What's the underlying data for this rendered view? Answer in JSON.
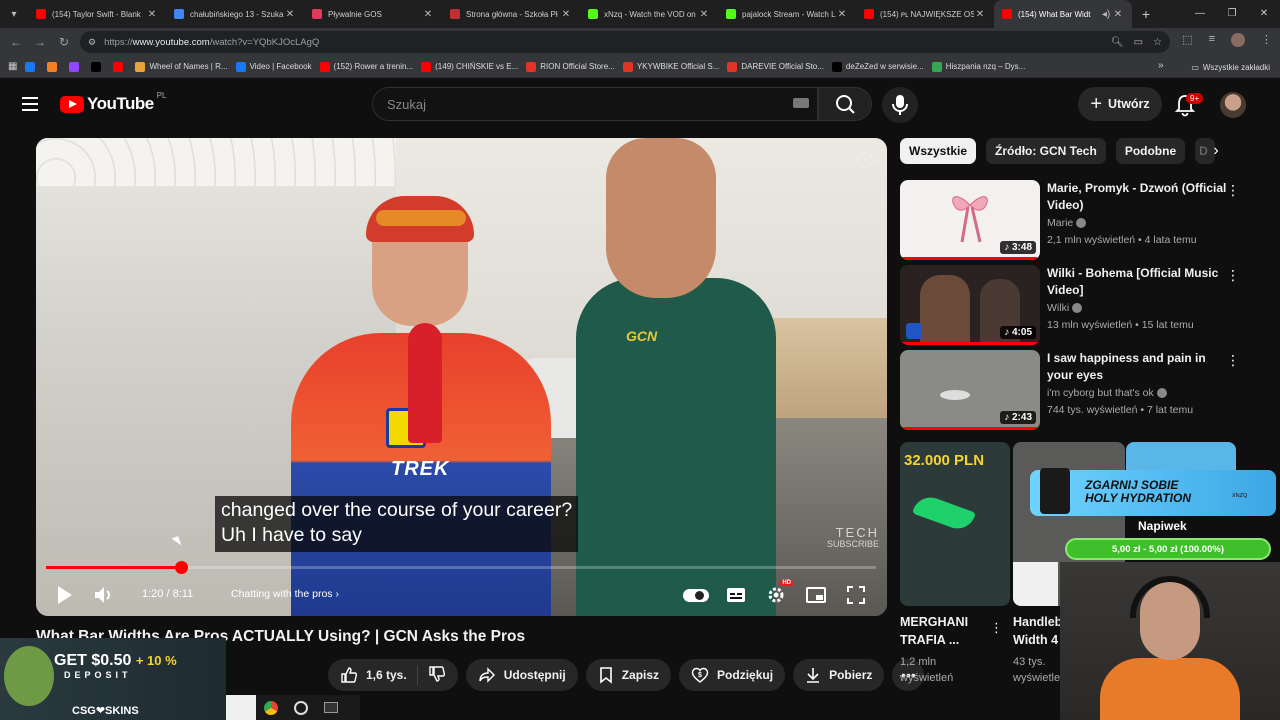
{
  "browser": {
    "tabs": [
      {
        "title": "(154) Taylor Swift - Blank",
        "icon": "youtube-icon",
        "color": "#ff0000"
      },
      {
        "title": "chałubińskiego 13 - Szuka",
        "icon": "google-icon",
        "color": "#4285f4"
      },
      {
        "title": "Pływalnie GOS",
        "icon": "bookmark-icon",
        "color": "#e03a5a"
      },
      {
        "title": "Strona główna - Szkoła Pł",
        "icon": "site-icon",
        "color": "#c03030"
      },
      {
        "title": "xNzq - Watch the VOD on",
        "icon": "kick-icon",
        "color": "#53fc18"
      },
      {
        "title": "pajalock Stream - Watch L",
        "icon": "kick-icon",
        "color": "#53fc18"
      },
      {
        "title": "(154) ᴘʟ NAJWIĘKSZE OSI",
        "icon": "youtube-icon",
        "color": "#ff0000"
      },
      {
        "title": "(154) What Bar Widt",
        "icon": "youtube-icon",
        "color": "#ff0000",
        "active": true
      }
    ],
    "url_prefix": "https://",
    "url_domain": "www.youtube.com",
    "url_path": "/watch?v=YQbKJOcLAgQ",
    "bookmarks": [
      {
        "label": "",
        "icon": "facebook-icon",
        "color": "#1877f2"
      },
      {
        "label": "",
        "icon": "orange-icon",
        "color": "#f58220"
      },
      {
        "label": "",
        "icon": "twitch-icon",
        "color": "#9146ff"
      },
      {
        "label": "",
        "icon": "x-icon",
        "color": "#000000"
      },
      {
        "label": "",
        "icon": "youtube-icon",
        "color": "#ff0000"
      },
      {
        "label": "Wheel of Names | R...",
        "icon": "wheel-icon",
        "color": "#e8a33a"
      },
      {
        "label": "Video | Facebook",
        "icon": "facebook-icon",
        "color": "#1877f2"
      },
      {
        "label": "(152) Rower a trenin...",
        "icon": "youtube-icon",
        "color": "#ff0000"
      },
      {
        "label": "(149) CHIŃSKIE vs E...",
        "icon": "youtube-icon",
        "color": "#ff0000"
      },
      {
        "label": "RION Official Store...",
        "icon": "ali-icon",
        "color": "#e43225"
      },
      {
        "label": "YKYWBIKE Official S...",
        "icon": "ali-icon",
        "color": "#e43225"
      },
      {
        "label": "DAREVIE Official Sto...",
        "icon": "ali-icon",
        "color": "#e43225"
      },
      {
        "label": "deZeZed w serwisie...",
        "icon": "x-icon",
        "color": "#000000"
      },
      {
        "label": "Hiszpania nzq – Dys...",
        "icon": "drive-icon",
        "color": "#34a853"
      }
    ],
    "all_bookmarks": "Wszystkie zakładki"
  },
  "youtube": {
    "logo_text": "YouTube",
    "country": "PL",
    "search_placeholder": "Szukaj",
    "create_label": "Utwórz",
    "notifications_badge": "9+"
  },
  "player": {
    "caption_line1": "changed over the course of your career?",
    "caption_line2": "Uh I have to say",
    "time": "1:20 / 8:11",
    "progress": 0.163,
    "chapter": "Chatting with the pros",
    "watermark_line1": "TECH",
    "watermark_line2": "SUBSCRIBE",
    "kit_sponsor": "TREK",
    "host_logo": "GCN"
  },
  "video": {
    "title": "What Bar Widths Are Pros ACTUALLY Using? | GCN Asks the Pros",
    "likes": "1,6 tys.",
    "share": "Udostępnij",
    "save": "Zapisz",
    "thanks": "Podziękuj",
    "download": "Pobierz"
  },
  "sidebar": {
    "chips": [
      "Wszystkie",
      "Źródło: GCN Tech",
      "Podobne",
      "D"
    ],
    "recommendations": [
      {
        "title": "Marie, Promyk - Dzwoń (Official Video)",
        "channel": "Marie",
        "meta": "2,1 mln wyświetleń • 4 lata temu",
        "duration": "3:48",
        "progress": 0.98,
        "thumb": "#f4f0f0"
      },
      {
        "title": "Wilki - Bohema [Official Music Video]",
        "channel": "Wilki",
        "meta": "13 mln wyświetleń • 15 lat temu",
        "duration": "4:05",
        "progress": 1.0,
        "thumb": "#2a2220"
      },
      {
        "title": "I saw happiness and pain in your eyes",
        "channel": "i'm cyborg but that's ok",
        "meta": "744 tys. wyświetleń • 7 lat temu",
        "duration": "2:43",
        "progress": 1.0,
        "thumb": "#8a8a86"
      }
    ],
    "grid": [
      {
        "title_l1": "MERGHANI",
        "title_l2": "TRAFIA ...",
        "meta_l1": "1,2 mln",
        "meta_l2": "wyświetleń",
        "thumb_text": "32.000 PLN"
      },
      {
        "title_l1": "Handleb",
        "title_l2": "Width 4",
        "meta_l1": "43 tys.",
        "meta_l2": "wyświetle"
      }
    ]
  },
  "overlays": {
    "promo_l1": "ZGARNIJ SOBIE",
    "promo_l2": "HOLY HYDRATION",
    "promo_code": "XNZQ",
    "napiwek": "Napiwek",
    "tip_amount": "5,00 zł",
    "tip_goal": "5,00 zł",
    "tip_percent": "100.00%",
    "ad_main_l1": "GET $0.50",
    "ad_main_l2": "+ 10 %",
    "ad_sub": "DEPOSIT",
    "ad_brand": "CSG❤SKINS"
  }
}
